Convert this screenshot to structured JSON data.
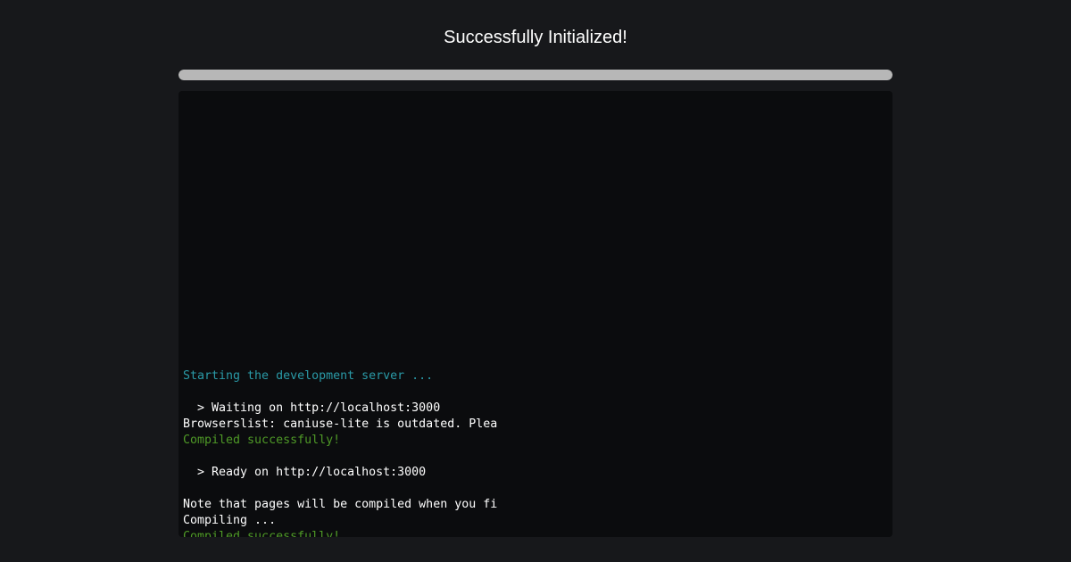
{
  "header": {
    "title": "Successfully Initialized!"
  },
  "progress": {
    "value": 1.0,
    "track_color": "#3a3b3e",
    "fill_color": "#b7b7b7"
  },
  "colors": {
    "background": "#17181b",
    "terminal_background": "#0b0c0e",
    "info": "#2a9aa7",
    "normal": "#ffffff",
    "success": "#4f9a27"
  },
  "terminal": {
    "lines": [
      {
        "text": "Starting the development server ...",
        "kind": "info"
      },
      {
        "text": "",
        "kind": "normal"
      },
      {
        "text": "  > Waiting on http://localhost:3000",
        "kind": "normal"
      },
      {
        "text": "Browserslist: caniuse-lite is outdated. Plea",
        "kind": "normal"
      },
      {
        "text": "Compiled successfully!",
        "kind": "success"
      },
      {
        "text": "",
        "kind": "normal"
      },
      {
        "text": "  > Ready on http://localhost:3000",
        "kind": "normal"
      },
      {
        "text": "",
        "kind": "normal"
      },
      {
        "text": "Note that pages will be compiled when you fi",
        "kind": "normal"
      },
      {
        "text": "Compiling ...",
        "kind": "normal"
      },
      {
        "text": "Compiled successfully!",
        "kind": "success"
      }
    ]
  }
}
